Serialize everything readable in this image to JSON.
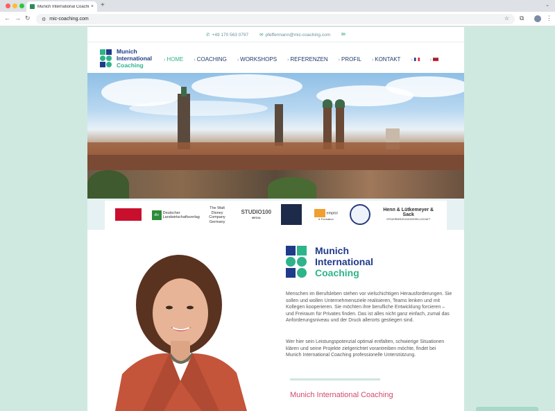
{
  "browser": {
    "tab_title": "Munich International Coachin",
    "tab_close": "×",
    "new_tab": "+",
    "url": "mic-coaching.com"
  },
  "contact": {
    "phone": "+49 170 563 0797",
    "email": "pfeffermann@mic-coaching.com",
    "social": "in"
  },
  "logo": {
    "line1": "Munich",
    "line2": "International",
    "line3": "Coaching"
  },
  "nav": {
    "items": [
      "HOME",
      "COACHING",
      "WORKSHOPS",
      "REFERENZEN",
      "PROFIL",
      "KONTAKT"
    ]
  },
  "partners": {
    "dlv_short": "dlv",
    "dlv": "Deutscher Landwirtschaftsverlag",
    "disney": "The Walt Disney Company Germany",
    "studio": "STUDIO100",
    "studio_sub": "MEDIA",
    "emploi": "emploi",
    "emploi_sub": "& Formation",
    "henn": "Henn & Lütkemeyer & Sack",
    "henn_sub": "STEUERBERATUNGSGESELLSCHAFT"
  },
  "main": {
    "para1": "Menschen im Berufsleben stehen vor vielschichtigen Herausforderungen. Sie sollen und wollen Unternehmensziele realisieren, Teams lenken und mit Kollegen kooperieren. Sie möchten ihre berufliche Entwicklung forcieren – und Freiraum für Privates finden. Das ist alles nicht ganz einfach, zumal das Anforderungsniveau und der Druck allerorts gestiegen sind.",
    "para2": "Wer hier sein Leistungspotenzial optimal entfalten, schwierige Situationen klären und seine Projekte zielgerichtet vorantreiben möchte, findet bei Munich International Coaching professionelle Unterstützung.",
    "section_title": "Munich International Coaching"
  },
  "colors": {
    "brand_blue": "#1f3a8a",
    "brand_green": "#2fb38a",
    "accent_pink": "#d24a6a"
  }
}
